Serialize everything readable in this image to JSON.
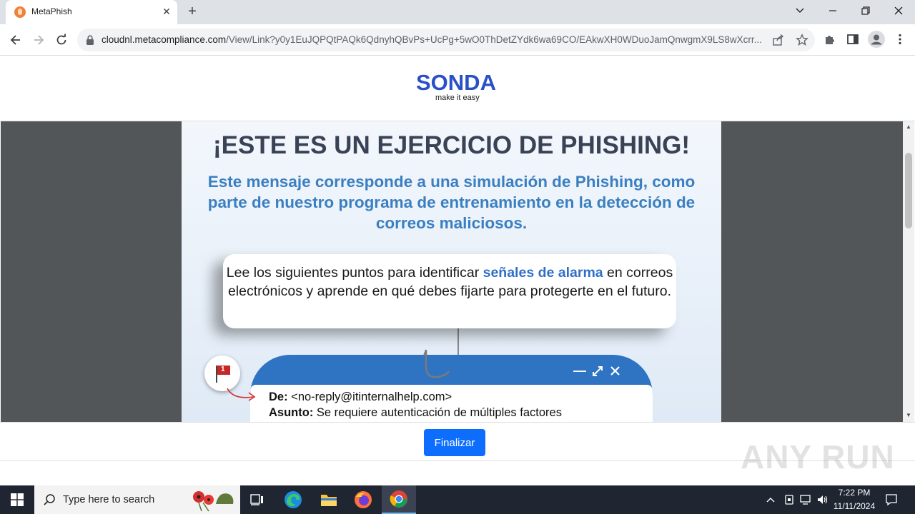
{
  "browser": {
    "tab_title": "MetaPhish",
    "tab_close": "✕",
    "new_tab": "+",
    "url_host": "cloudnl.metacompliance.com",
    "url_path": "/View/Link?y0y1EuJQPQtPAQk6QdnyhQBvPs+UcPg+5wO0ThDetZYdk6wa69CO/EAkwXH0WDuoJamQnwgmX9LS8wXcrr..."
  },
  "header": {
    "logo": "SONDA",
    "tagline": "make it easy"
  },
  "document": {
    "title": "¡ESTE ES UN EJERCICIO DE PHISHING!",
    "subtitle": "Este mensaje corresponde a una simulación de Phishing, como parte de nuestro programa de entrenamiento en la detección de correos maliciosos.",
    "card_before": "Lee los siguientes puntos para identificar ",
    "card_highlight": "señales de alarma",
    "card_after": " en correos electrónicos y aprende en qué debes fijarte para protegerte en el futuro.",
    "flag_number": "1",
    "from_label": "De:",
    "from_value": " <no-reply@itinternalhelp.com>",
    "subject_label": "Asunto:",
    "subject_value": " Se requiere autenticación de múltiples factores"
  },
  "footer": {
    "finish_button": "Finalizar"
  },
  "watermark": "ANY RUN",
  "taskbar": {
    "search_placeholder": "Type here to search",
    "time": "7:22 PM",
    "date": "11/11/2024"
  },
  "colors": {
    "brand_blue": "#2a50c8",
    "title_dark": "#3a4256",
    "subtitle_blue": "#3a7fc2",
    "mail_header_blue": "#2f73c3",
    "button_blue": "#0d6efd"
  }
}
